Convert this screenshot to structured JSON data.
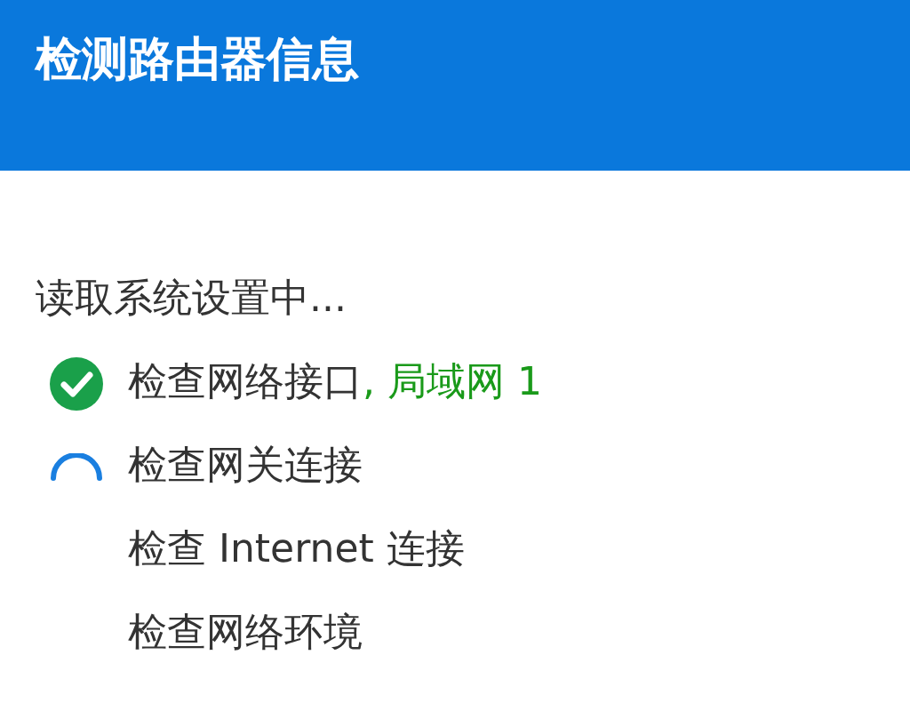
{
  "header": {
    "title": "检测路由器信息"
  },
  "status_text": "读取系统设置中...",
  "steps": [
    {
      "label": "检查网络接口",
      "detail": ", 局域网 1",
      "kind": "done"
    },
    {
      "label": "检查网关连接",
      "kind": "loading"
    },
    {
      "label": "检查 Internet 连接",
      "kind": "pending"
    },
    {
      "label": "检查网络环境",
      "kind": "pending"
    }
  ]
}
